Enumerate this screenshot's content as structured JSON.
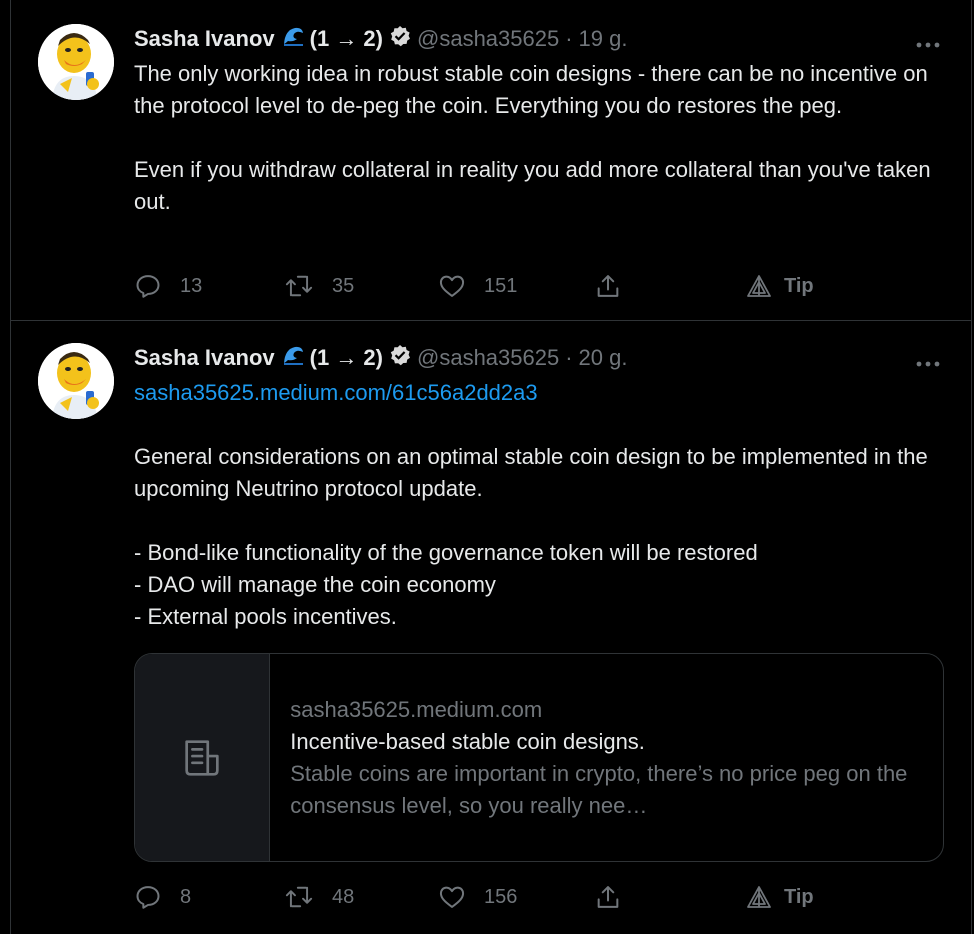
{
  "tweets": [
    {
      "name": "Sasha Ivanov",
      "ranking": "(1 → 2)",
      "handle": "@sasha35625",
      "time": "19 g.",
      "text": "The only working idea in robust stable coin designs - there can be no incentive on the protocol level to de-peg the coin. Everything you do restores the peg.\n\nEven if you withdraw collateral in reality you add more collateral than you've taken out.",
      "replies": "13",
      "retweets": "35",
      "likes": "151",
      "tip": "Tip"
    },
    {
      "name": "Sasha Ivanov",
      "ranking": "(1 → 2)",
      "handle": "@sasha35625",
      "time": "20 g.",
      "link": "sasha35625.medium.com/61c56a2dd2a3",
      "text": "General considerations on an optimal stable coin design to be implemented in the upcoming Neutrino protocol update.\n\n- Bond-like functionality of the governance token will be restored\n- DAO will manage the coin economy\n- External pools incentives.",
      "card": {
        "domain": "sasha35625.medium.com",
        "title": "Incentive-based stable coin designs.",
        "description": "Stable coins are important in crypto, there’s no price peg on the consensus level, so you really nee…"
      },
      "replies": "8",
      "retweets": "48",
      "likes": "156",
      "tip": "Tip"
    }
  ],
  "separator": "·",
  "colors": {
    "background": "#000000",
    "primary_text": "#e7e9ea",
    "secondary_text": "#71767b",
    "link": "#1d9bf0",
    "border": "#2f3336"
  },
  "icons": [
    "avatar",
    "wave-icon",
    "verified-icon",
    "more-icon",
    "reply-icon",
    "retweet-icon",
    "like-icon",
    "share-icon",
    "tip-icon",
    "article-icon"
  ]
}
